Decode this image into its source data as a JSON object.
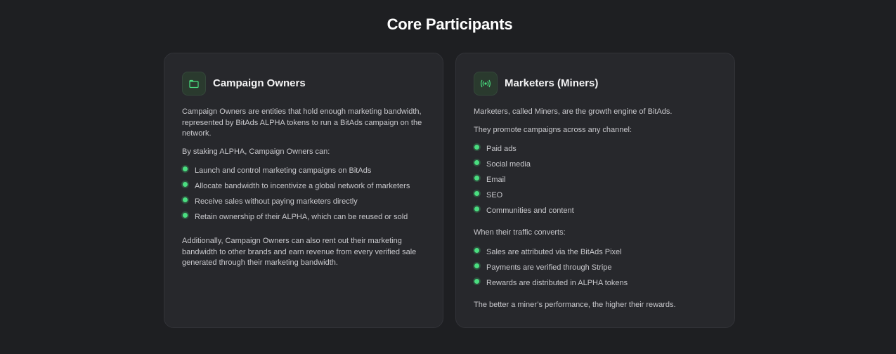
{
  "heading": "Core Participants",
  "accent_color": "#4ade80",
  "cards": [
    {
      "title": "Campaign Owners",
      "icon": "folder-icon",
      "intro": "Campaign Owners are entities that hold enough marketing bandwidth, represented by BitAds ALPHA tokens to run a BitAds campaign on the network.",
      "lead": "By staking ALPHA, Campaign Owners can:",
      "items": [
        "Launch and control marketing campaigns on BitAds",
        "Allocate bandwidth to incentivize a global network of marketers",
        "Receive sales without paying marketers directly",
        "Retain ownership of their ALPHA, which can be reused or sold"
      ],
      "outro": "Additionally, Campaign Owners can also rent out their marketing bandwidth to other brands and earn revenue from every verified sale generated through their marketing bandwidth."
    },
    {
      "title": "Marketers (Miners)",
      "icon": "broadcast-icon",
      "intro": "Marketers, called Miners, are the growth engine of BitAds.",
      "lead": "They promote campaigns across any channel:",
      "items": [
        "Paid ads",
        "Social media",
        "Email",
        "SEO",
        "Communities and content"
      ],
      "lead2": "When their traffic converts:",
      "items2": [
        "Sales are attributed via the BitAds Pixel",
        "Payments are verified through Stripe",
        "Rewards are distributed in ALPHA tokens"
      ],
      "outro": "The better a miner’s performance, the higher their rewards."
    }
  ]
}
